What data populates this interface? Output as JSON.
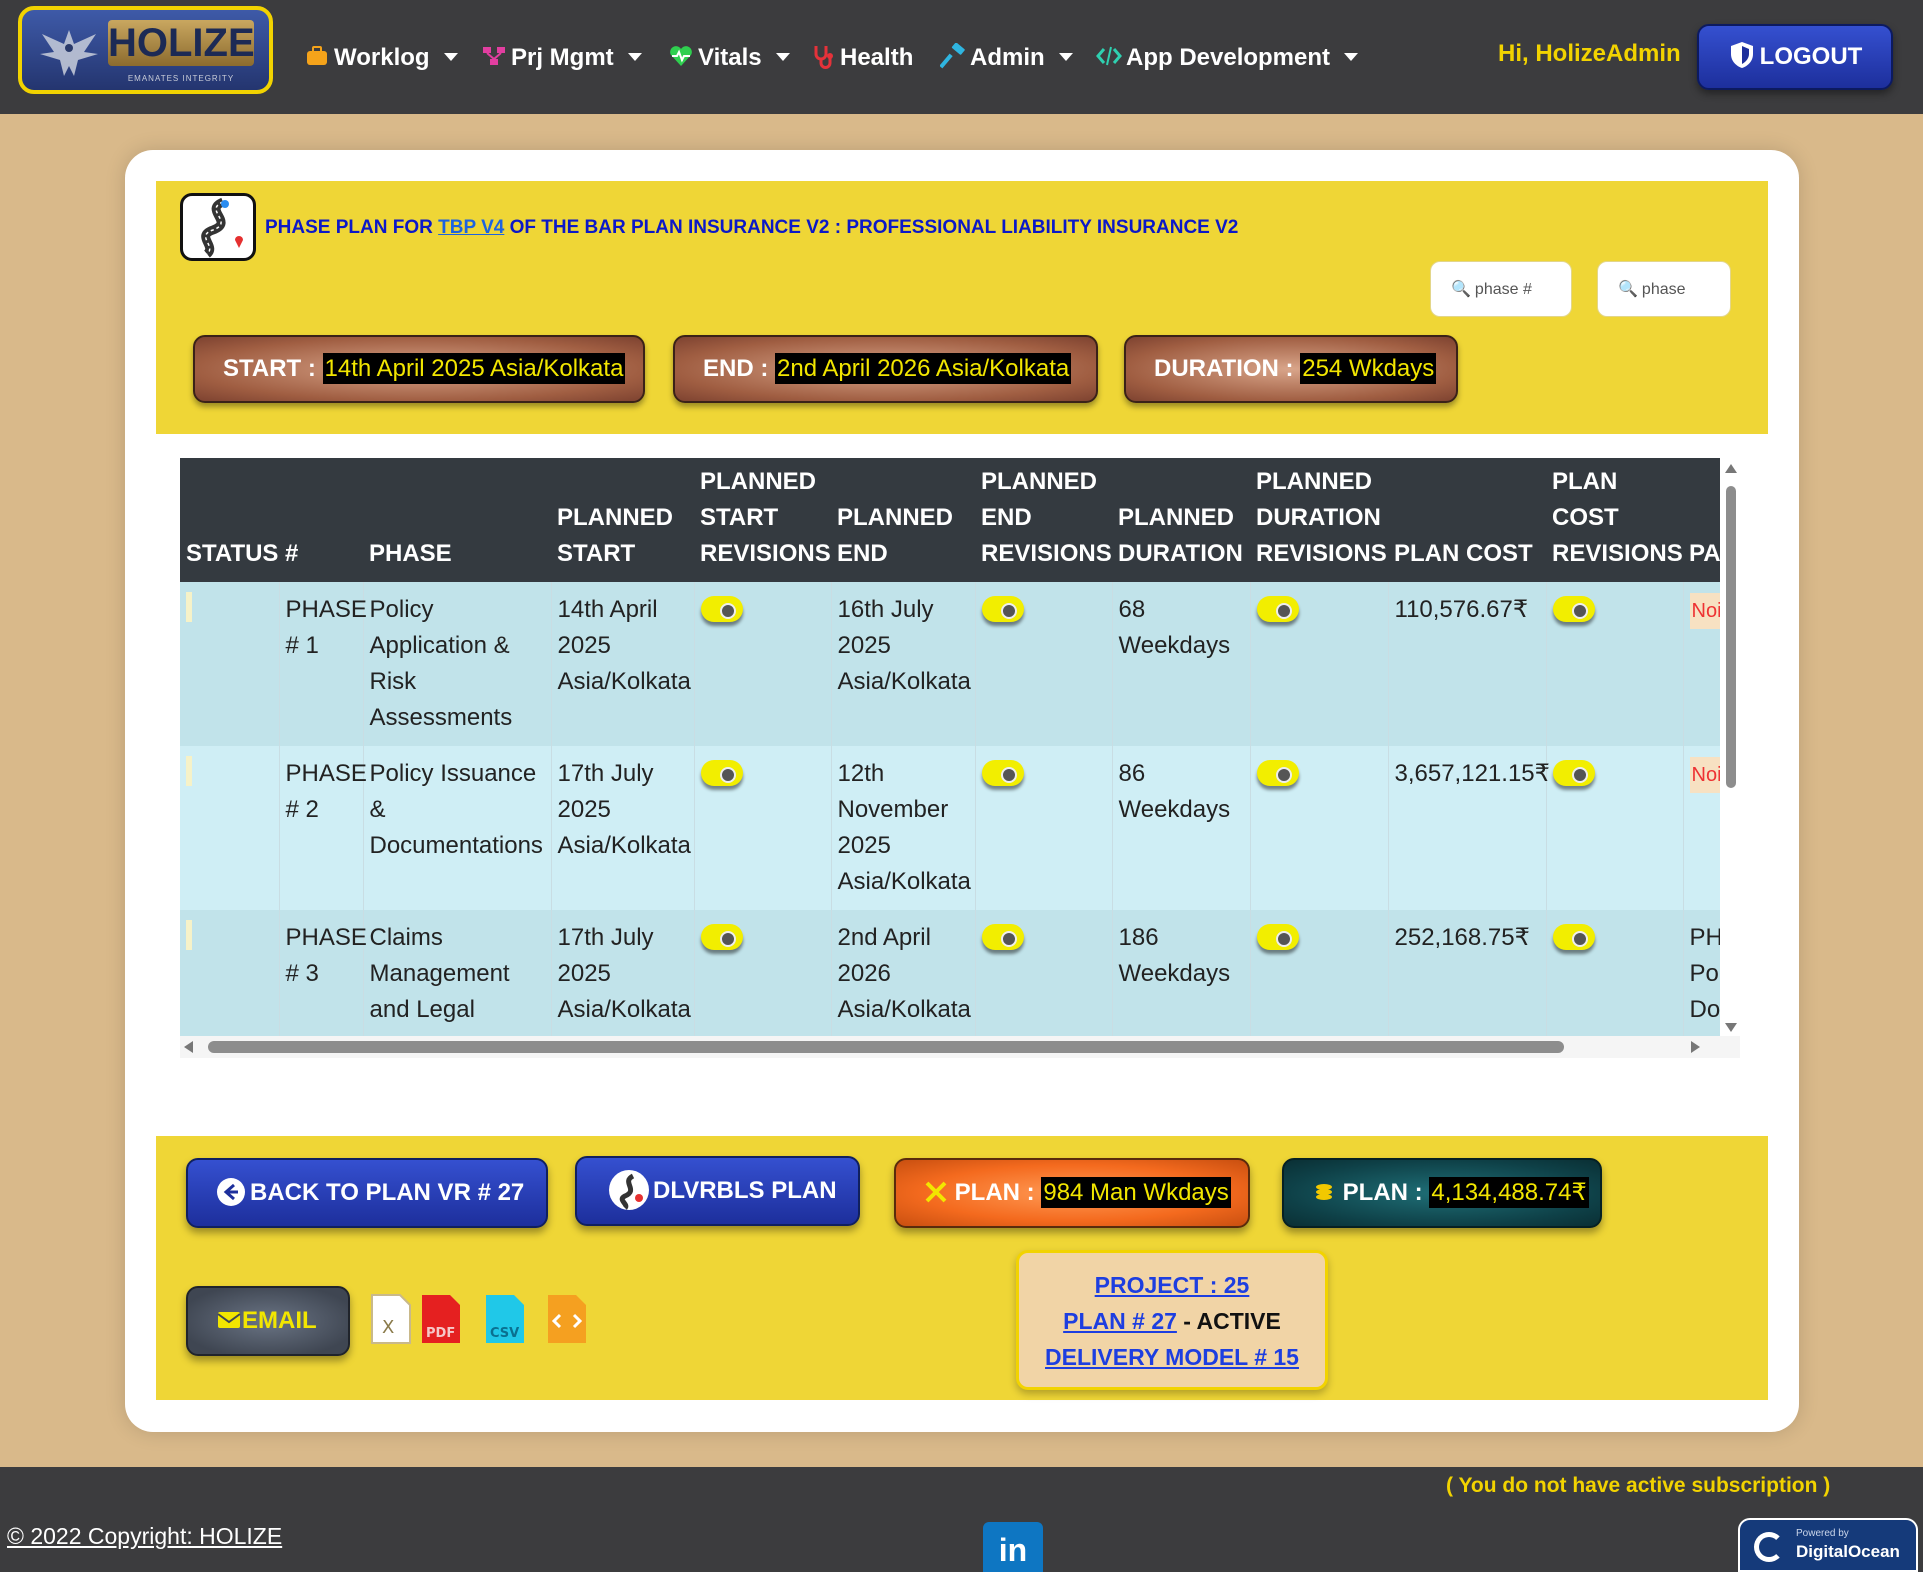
{
  "brand": {
    "name": "HOLIZE",
    "tagline": "EMANATES INTEGRITY"
  },
  "nav": {
    "items": [
      {
        "label": "Worklog",
        "icon": "briefcase-icon"
      },
      {
        "label": "Prj Mgmt",
        "icon": "project-tree-icon"
      },
      {
        "label": "Vitals",
        "icon": "heartbeat-icon"
      },
      {
        "label": "Health",
        "icon": "stethoscope-icon"
      },
      {
        "label": "Admin",
        "icon": "hammer-icon"
      },
      {
        "label": "App Development",
        "icon": "code-icon"
      }
    ],
    "greeting": "Hi, HolizeAdmin",
    "logout": "LOGOUT"
  },
  "header": {
    "title_prefix": "PHASE PLAN FOR",
    "title_link": "TBP V4",
    "title_suffix": "OF THE BAR PLAN INSURANCE V2 : PROFESSIONAL LIABILITY INSURANCE V2",
    "search_number_placeholder": "phase #",
    "search_phase_placeholder": "phase"
  },
  "summary": {
    "start_label": "START :",
    "start_value": "14th April 2025 Asia/Kolkata",
    "end_label": "END :",
    "end_value": "2nd April 2026 Asia/Kolkata",
    "duration_label": "DURATION :",
    "duration_value": "254 Wkdays"
  },
  "table": {
    "columns": [
      "STATUS",
      "#",
      "PHASE",
      "PLANNED START",
      "PLANNED START REVISIONS",
      "PLANNED END",
      "PLANNED END REVISIONS",
      "PLANNED DURATION",
      "PLANNED DURATION REVISIONS",
      "PLAN COST",
      "PLAN COST REVISIONS",
      "PA PH"
    ],
    "rows": [
      {
        "num": "PHASE # 1",
        "phase": "Policy Application & Risk Assessments",
        "start": "14th April 2025 Asia/Kolkata",
        "end": "16th July 2025 Asia/Kolkata",
        "duration": "68 Weekdays",
        "cost": "110,576.67₹",
        "parent": "Noi"
      },
      {
        "num": "PHASE # 2",
        "phase": "Policy Issuance & Documentations",
        "start": "17th July 2025 Asia/Kolkata",
        "end": "12th November 2025 Asia/Kolkata",
        "duration": "86 Weekdays",
        "cost": "3,657,121.15₹",
        "parent": "Noi"
      },
      {
        "num": "PHASE # 3",
        "phase": "Claims Management and Legal Support",
        "start": "17th July 2025 Asia/Kolkata",
        "end": "2nd April 2026 Asia/Kolkata",
        "duration": "186 Weekdays",
        "cost": "252,168.75₹",
        "parent": "PHA Pol & Doc"
      }
    ]
  },
  "actions": {
    "back": "BACK TO PLAN VR # 27",
    "deliverables": "DLVRBLS PLAN",
    "effort_label": "PLAN :",
    "effort_value": "984 Man Wkdays",
    "cost_label": "PLAN :",
    "cost_value": "4,134,488.74₹",
    "email": "EMAIL",
    "exports": [
      "excel-icon",
      "pdf-icon",
      "csv-icon",
      "html-code-icon"
    ]
  },
  "project_box": {
    "project": "PROJECT : 25",
    "plan": "PLAN # 27",
    "plan_status": "- ACTIVE",
    "delivery_model": "DELIVERY MODEL # 15"
  },
  "footer": {
    "subscription_note": "( You do not have active subscription )",
    "copyright": "© 2022 Copyright: HOLIZE",
    "linkedin": "in",
    "do_small": "Powered by",
    "do_big": "DigitalOcean"
  }
}
